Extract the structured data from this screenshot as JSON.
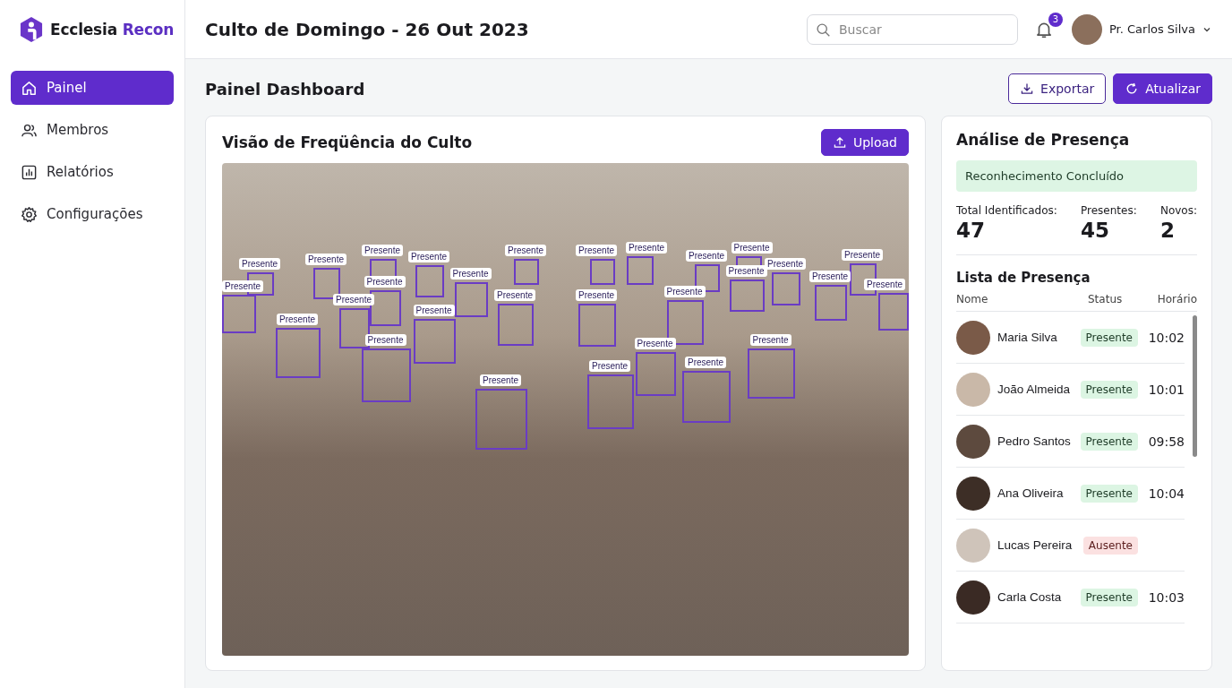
{
  "brand": {
    "name_first": "Ecclesia",
    "name_second": "Recon"
  },
  "sidebar": {
    "items": [
      {
        "label": "Painel",
        "selected": true
      },
      {
        "label": "Membros",
        "selected": false
      },
      {
        "label": "Relatórios",
        "selected": false
      },
      {
        "label": "Configurações",
        "selected": false
      }
    ]
  },
  "header": {
    "title": "Culto de Domingo - 26 Out 2023",
    "search": {
      "placeholder": "Buscar"
    },
    "notifications": "3",
    "user": "Pr. Carlos Silva"
  },
  "page": {
    "title": "Painel Dashboard",
    "buttons": [
      {
        "label": "Exportar",
        "kind": "outline"
      },
      {
        "label": "Atualizar",
        "kind": "primary"
      }
    ]
  },
  "viewer": {
    "title": "Visão de Freqüência do Culto",
    "upload": "Upload",
    "detections": [
      {
        "label": "Presente"
      },
      {
        "label": "Presente"
      },
      {
        "label": "Presente"
      },
      {
        "label": "Presente"
      },
      {
        "label": "Presente"
      },
      {
        "label": "Presente"
      },
      {
        "label": "Presente"
      },
      {
        "label": "Presente"
      },
      {
        "label": "Presente"
      },
      {
        "label": "Presente"
      },
      {
        "label": "Presente"
      },
      {
        "label": "Presente"
      },
      {
        "label": "Presente"
      },
      {
        "label": "Presente"
      },
      {
        "label": "Presente"
      },
      {
        "label": "Presente"
      },
      {
        "label": "Presente"
      },
      {
        "label": "Presente"
      },
      {
        "label": "Presente"
      },
      {
        "label": "Presente"
      },
      {
        "label": "Presente"
      },
      {
        "label": "Presente"
      },
      {
        "label": "Presente"
      },
      {
        "label": "Presente"
      },
      {
        "label": "Presente"
      },
      {
        "label": "Presente"
      },
      {
        "label": "Presente"
      },
      {
        "label": "Presente"
      },
      {
        "label": "Presente"
      }
    ]
  },
  "analysis": {
    "title": "Análise de Presença",
    "status": "Reconhecimento Concluído",
    "stats": [
      {
        "label": "Total Identificados:",
        "value": "47"
      },
      {
        "label": "Presentes:",
        "value": "45"
      },
      {
        "label": "Novos:",
        "value": "2"
      }
    ],
    "list_title": "Lista de Presença",
    "columns": [
      "Nome",
      "Status",
      "Horário"
    ],
    "rows": [
      {
        "name": "Maria Silva",
        "status": "Presente",
        "kind": "present",
        "time": "10:02"
      },
      {
        "name": "João Almeida",
        "status": "Presente",
        "kind": "present",
        "time": "10:01"
      },
      {
        "name": "Pedro Santos",
        "status": "Presente",
        "kind": "present",
        "time": "09:58"
      },
      {
        "name": "Ana Oliveira",
        "status": "Presente",
        "kind": "present",
        "time": "10:04"
      },
      {
        "name": "Lucas Pereira",
        "status": "Ausente",
        "kind": "absent"
      },
      {
        "name": "Carla Costa",
        "status": "Presente",
        "kind": "present",
        "time": "10:03"
      }
    ]
  }
}
